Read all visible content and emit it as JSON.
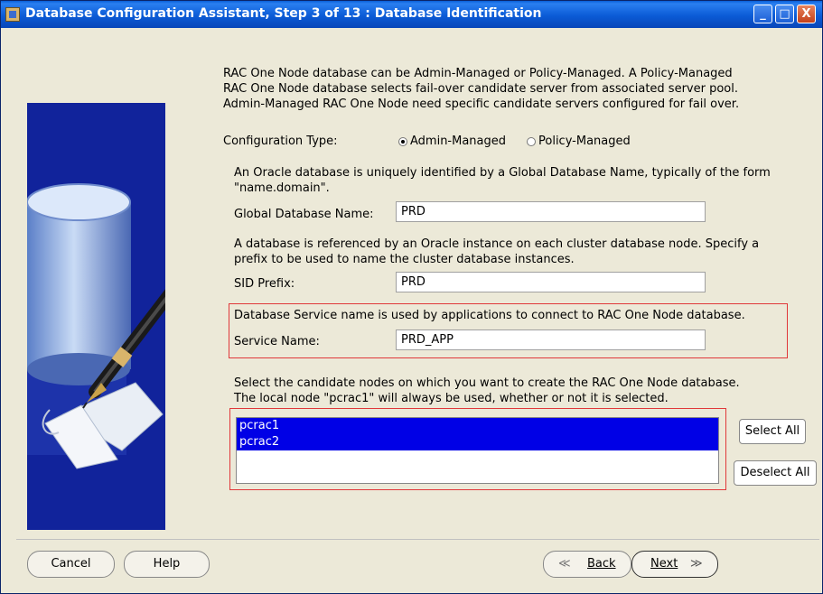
{
  "window": {
    "title": "Database Configuration Assistant, Step 3 of 13 : Database Identification",
    "controls": {
      "minimize": "_",
      "maximize": "□",
      "close": "X"
    }
  },
  "intro": {
    "line1": "RAC One Node database can be Admin-Managed or Policy-Managed. A Policy-Managed",
    "line2": "RAC One Node database selects fail-over candidate server from associated server pool.",
    "line3": "Admin-Managed RAC One Node need specific candidate servers configured for fail over."
  },
  "config_type": {
    "label": "Configuration Type:",
    "options": [
      {
        "label": "Admin-Managed",
        "selected": true
      },
      {
        "label": "Policy-Managed",
        "selected": false
      }
    ]
  },
  "global_db": {
    "desc1": "An Oracle database is uniquely identified by a Global Database Name, typically of the form",
    "desc2": "\"name.domain\".",
    "label": "Global Database Name:",
    "value": "PRD"
  },
  "sid": {
    "desc1": "A database is referenced by an Oracle instance on each cluster database node. Specify a",
    "desc2": "prefix to be used to name the cluster database instances.",
    "label": "SID Prefix:",
    "value": "PRD"
  },
  "service": {
    "desc": "Database Service name is used by applications to connect to RAC One Node database.",
    "label": "Service Name:",
    "value": "PRD_APP"
  },
  "nodes": {
    "desc1": "Select the candidate nodes on which you want to create the RAC One Node database.",
    "desc2": "The local node \"pcrac1\" will always be used, whether or not it is selected.",
    "items": [
      "pcrac1",
      "pcrac2"
    ],
    "select_all": "Select All",
    "deselect_all": "Deselect All"
  },
  "footer": {
    "cancel": "Cancel",
    "help": "Help",
    "back": "Back",
    "next": "Next",
    "back_glyph": "≪",
    "next_glyph": "≫"
  },
  "colors": {
    "titlebar": "#0b5bd6",
    "selection": "#0000e6",
    "highlight_border": "#e0383a",
    "graphic_bg": "#11239b"
  }
}
